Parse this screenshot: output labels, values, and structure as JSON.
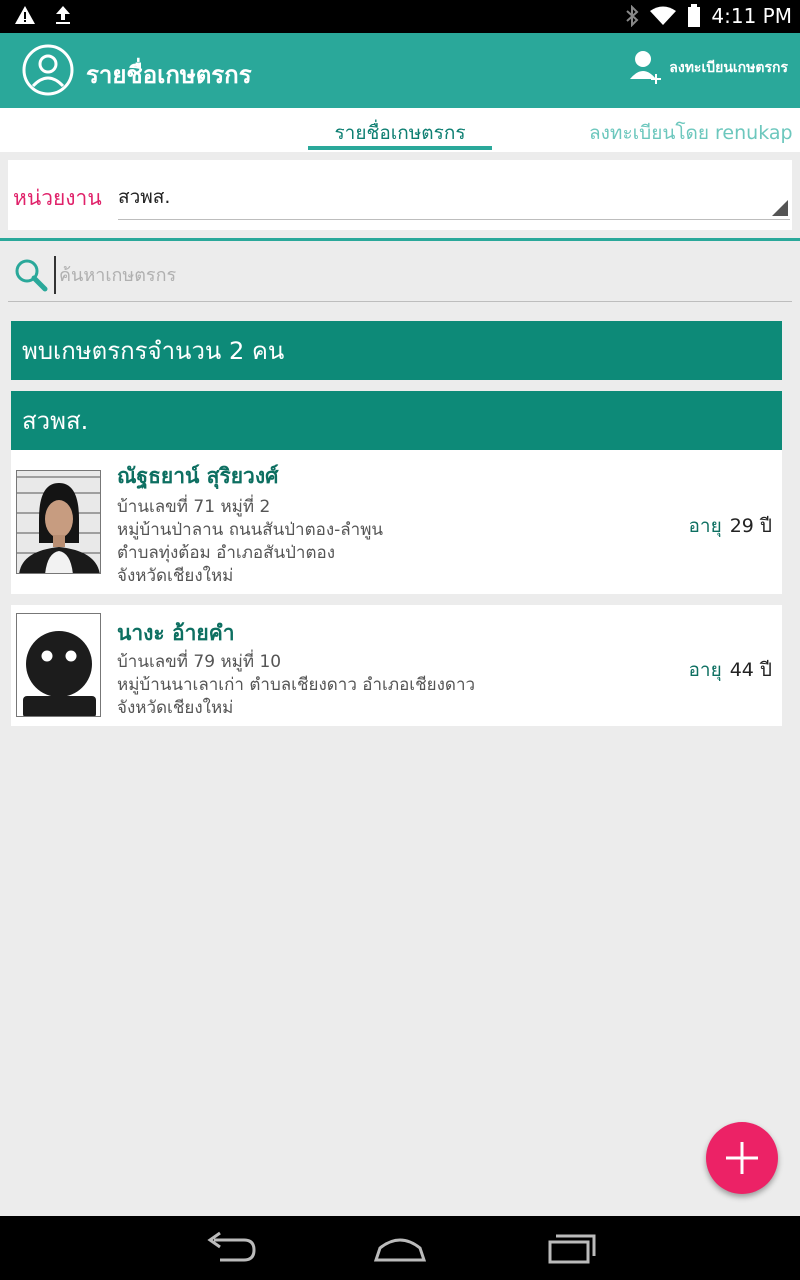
{
  "status_bar": {
    "time": "4:11 PM",
    "icons": [
      "warning-icon",
      "upload-icon",
      "bluetooth-icon",
      "wifi-icon",
      "battery-icon"
    ]
  },
  "app_bar": {
    "title": "รายชื่อเกษตรกร",
    "register_label": "ลงทะเบียนเกษตรกร",
    "icons": [
      "account-circle-icon",
      "add-user-icon"
    ]
  },
  "tabs": [
    {
      "label": "รายชื่อเกษตรกร",
      "active": true
    },
    {
      "label": "ลงทะเบียนโดย renukap",
      "active": false
    }
  ],
  "unit": {
    "label": "หน่วยงาน",
    "value": "สวพส."
  },
  "search": {
    "placeholder": "ค้นหาเกษตรกร"
  },
  "results": {
    "count_text": "พบเกษตรกรจำนวน 2 คน",
    "group_name": "สวพส."
  },
  "farmers": [
    {
      "name": "ณัฐธยาน์ สุริยวงศ์",
      "address_lines": [
        "บ้านเลขที่ 71 หมู่ที่ 2",
        "หมู่บ้านป่าลาน ถนนสันป่าตอง-ลำพูน",
        "ตำบลทุ่งต้อม อำเภอสันป่าตอง",
        "จังหวัดเชียงใหม่"
      ],
      "age_label": "อายุ",
      "age_value": "29 ปี",
      "photo": "mugshot-photo"
    },
    {
      "name": "นางะ อ้ายคำ",
      "address_lines": [
        "บ้านเลขที่ 79 หมู่ที่ 10",
        "หมู่บ้านนาเลาเก่า ตำบลเชียงดาว อำเภอเชียงดาว",
        "จังหวัดเชียงใหม่"
      ],
      "age_label": "อายุ",
      "age_value": "44 ปี",
      "photo": "placeholder-avatar"
    }
  ],
  "colors": {
    "primary": "#2aa89a",
    "header_dark": "#0d8a78",
    "name_text": "#0d6f61",
    "accent_pink": "#ec2266",
    "label_pink": "#e0226a"
  }
}
